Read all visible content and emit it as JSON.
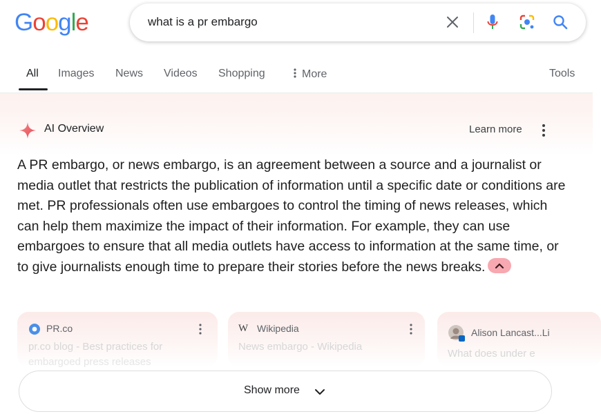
{
  "logo_text": "Google",
  "search": {
    "query": "what is a pr embargo"
  },
  "tabs": [
    {
      "label": "All"
    },
    {
      "label": "Images"
    },
    {
      "label": "News"
    },
    {
      "label": "Videos"
    },
    {
      "label": "Shopping"
    },
    {
      "label": "More"
    }
  ],
  "tools_label": "Tools",
  "ai_overview": {
    "title": "AI Overview",
    "learn_more": "Learn more",
    "text": "A PR embargo, or news embargo, is an agreement between a source and a journalist or media outlet that restricts the publication of information until a specific date or conditions are met. PR professionals often use embargoes to control the timing of news releases, which can help them maximize the impact of their information. For example, they can use embargoes to ensure that all media outlets have access to information at the same time, or to give journalists enough time to prepare their stories before the news breaks."
  },
  "sources": [
    {
      "site": "PR.co",
      "title": "pr.co blog - Best practices for",
      "subtitle": "embargoed press releases"
    },
    {
      "site": "Wikipedia",
      "title": "News embargo - Wikipedia",
      "subtitle": ""
    },
    {
      "site": "Alison Lancast...Li",
      "title": "What does under e",
      "subtitle": ""
    }
  ],
  "show_more_label": "Show more",
  "colors": {
    "google_blue": "#4285f4",
    "google_red": "#ea4335",
    "google_yellow": "#fbbc05",
    "google_green": "#34a853",
    "collapse_pill": "#f7a8b0"
  },
  "icons": [
    "clear-icon",
    "mic-icon",
    "lens-icon",
    "search-icon",
    "sparkle-icon",
    "kebab-menu-icon",
    "chevron-up-icon",
    "chevron-down-icon",
    "pr-co-favicon",
    "wikipedia-favicon",
    "avatar"
  ]
}
